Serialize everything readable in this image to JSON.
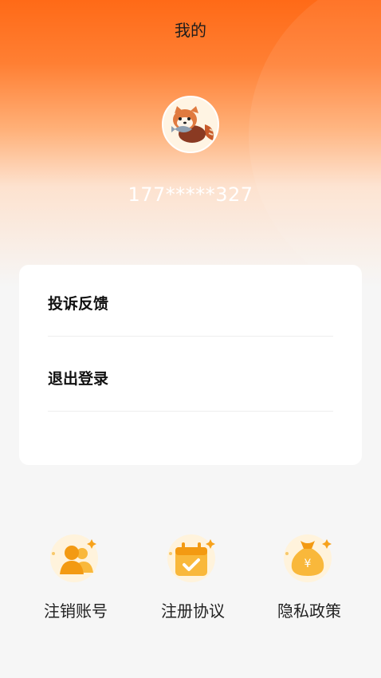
{
  "header": {
    "title": "我的"
  },
  "profile": {
    "avatar_icon": "red-panda-avatar-icon",
    "phone": "177*****327"
  },
  "menu": {
    "items": [
      {
        "label": "投诉反馈"
      },
      {
        "label": "退出登录"
      }
    ]
  },
  "shortcuts": [
    {
      "label": "注销账号",
      "icon": "users-icon"
    },
    {
      "label": "注册协议",
      "icon": "calendar-check-icon"
    },
    {
      "label": "隐私政策",
      "icon": "money-bag-icon"
    }
  ],
  "colors": {
    "accent": "#ff6a17",
    "icon_orange": "#f7a21b",
    "card_bg": "#ffffff"
  }
}
